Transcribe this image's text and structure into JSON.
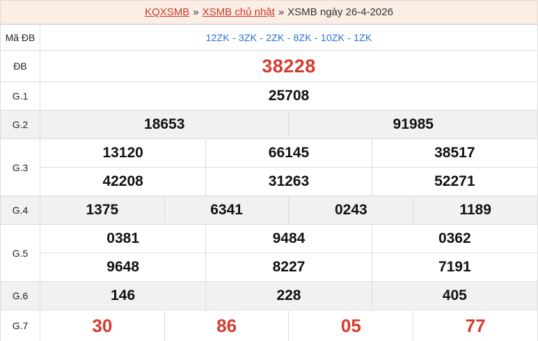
{
  "breadcrumb": {
    "home": "KQXSMB",
    "separator": "»",
    "section": "XSMB chủ nhật",
    "current": "XSMB ngày 26-4-2026"
  },
  "results": {
    "code": {
      "label": "Mã ĐB",
      "value": "12ZK - 3ZK - 2ZK - 8ZK - 10ZK - 1ZK"
    },
    "db": {
      "label": "ĐB",
      "value": "38228"
    },
    "g1": {
      "label": "G.1",
      "values": [
        "25708"
      ]
    },
    "g2": {
      "label": "G.2",
      "values": [
        "18653",
        "91985"
      ]
    },
    "g3": {
      "label": "G.3",
      "values": [
        "13120",
        "66145",
        "38517",
        "42208",
        "31263",
        "52271"
      ]
    },
    "g4": {
      "label": "G.4",
      "values": [
        "1375",
        "6341",
        "0243",
        "1189"
      ]
    },
    "g5": {
      "label": "G.5",
      "values": [
        "0381",
        "9484",
        "0362",
        "9648",
        "8227",
        "7191"
      ]
    },
    "g6": {
      "label": "G.6",
      "values": [
        "146",
        "228",
        "405"
      ]
    },
    "g7": {
      "label": "G.7",
      "values": [
        "30",
        "86",
        "05",
        "77"
      ]
    }
  },
  "colors": {
    "accent_red": "#d63a2f",
    "code_blue": "#1f6fd1",
    "header_bg": "#fbeee6",
    "row_gray": "#f1f1f1"
  }
}
